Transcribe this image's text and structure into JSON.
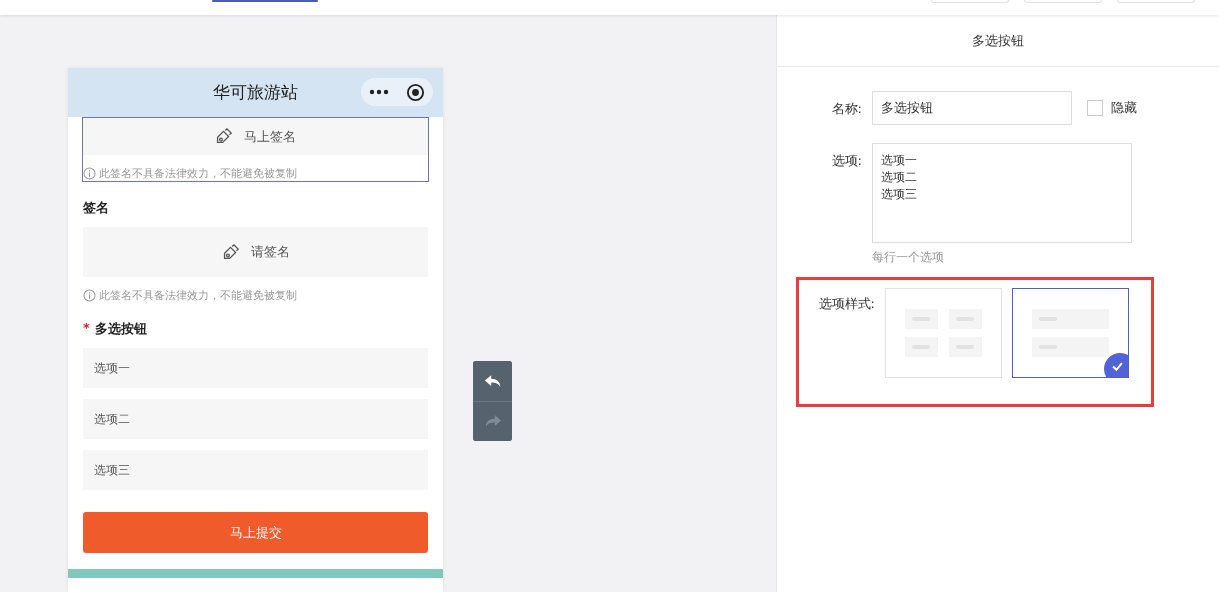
{
  "phone": {
    "title": "华可旅游站",
    "fields": [
      {
        "kind": "signature",
        "button": "马上签名",
        "hint": "此签名不具备法律效力，不能避免被复制",
        "selected": true
      },
      {
        "kind": "signature",
        "label": "签名",
        "button": "请签名",
        "hint": "此签名不具备法律效力，不能避免被复制",
        "selected": false
      },
      {
        "kind": "checkbox",
        "label": "多选按钮",
        "required_mark": "*",
        "selected": false,
        "options": [
          "选项一",
          "选项二",
          "选项三"
        ]
      }
    ],
    "submit": "马上提交"
  },
  "panel": {
    "title": "多选按钮",
    "name_label": "名称:",
    "name_value": "多选按钮",
    "hidden": {
      "label": "隐藏",
      "checked": false
    },
    "options_label": "选项:",
    "options_lines": [
      "选项一",
      "选项二",
      "选项三"
    ],
    "options_help": "每行一个选项",
    "style_label": "选项样式:",
    "styles": [
      {
        "kind": "grid",
        "selected": false
      },
      {
        "kind": "list",
        "selected": true
      }
    ]
  }
}
